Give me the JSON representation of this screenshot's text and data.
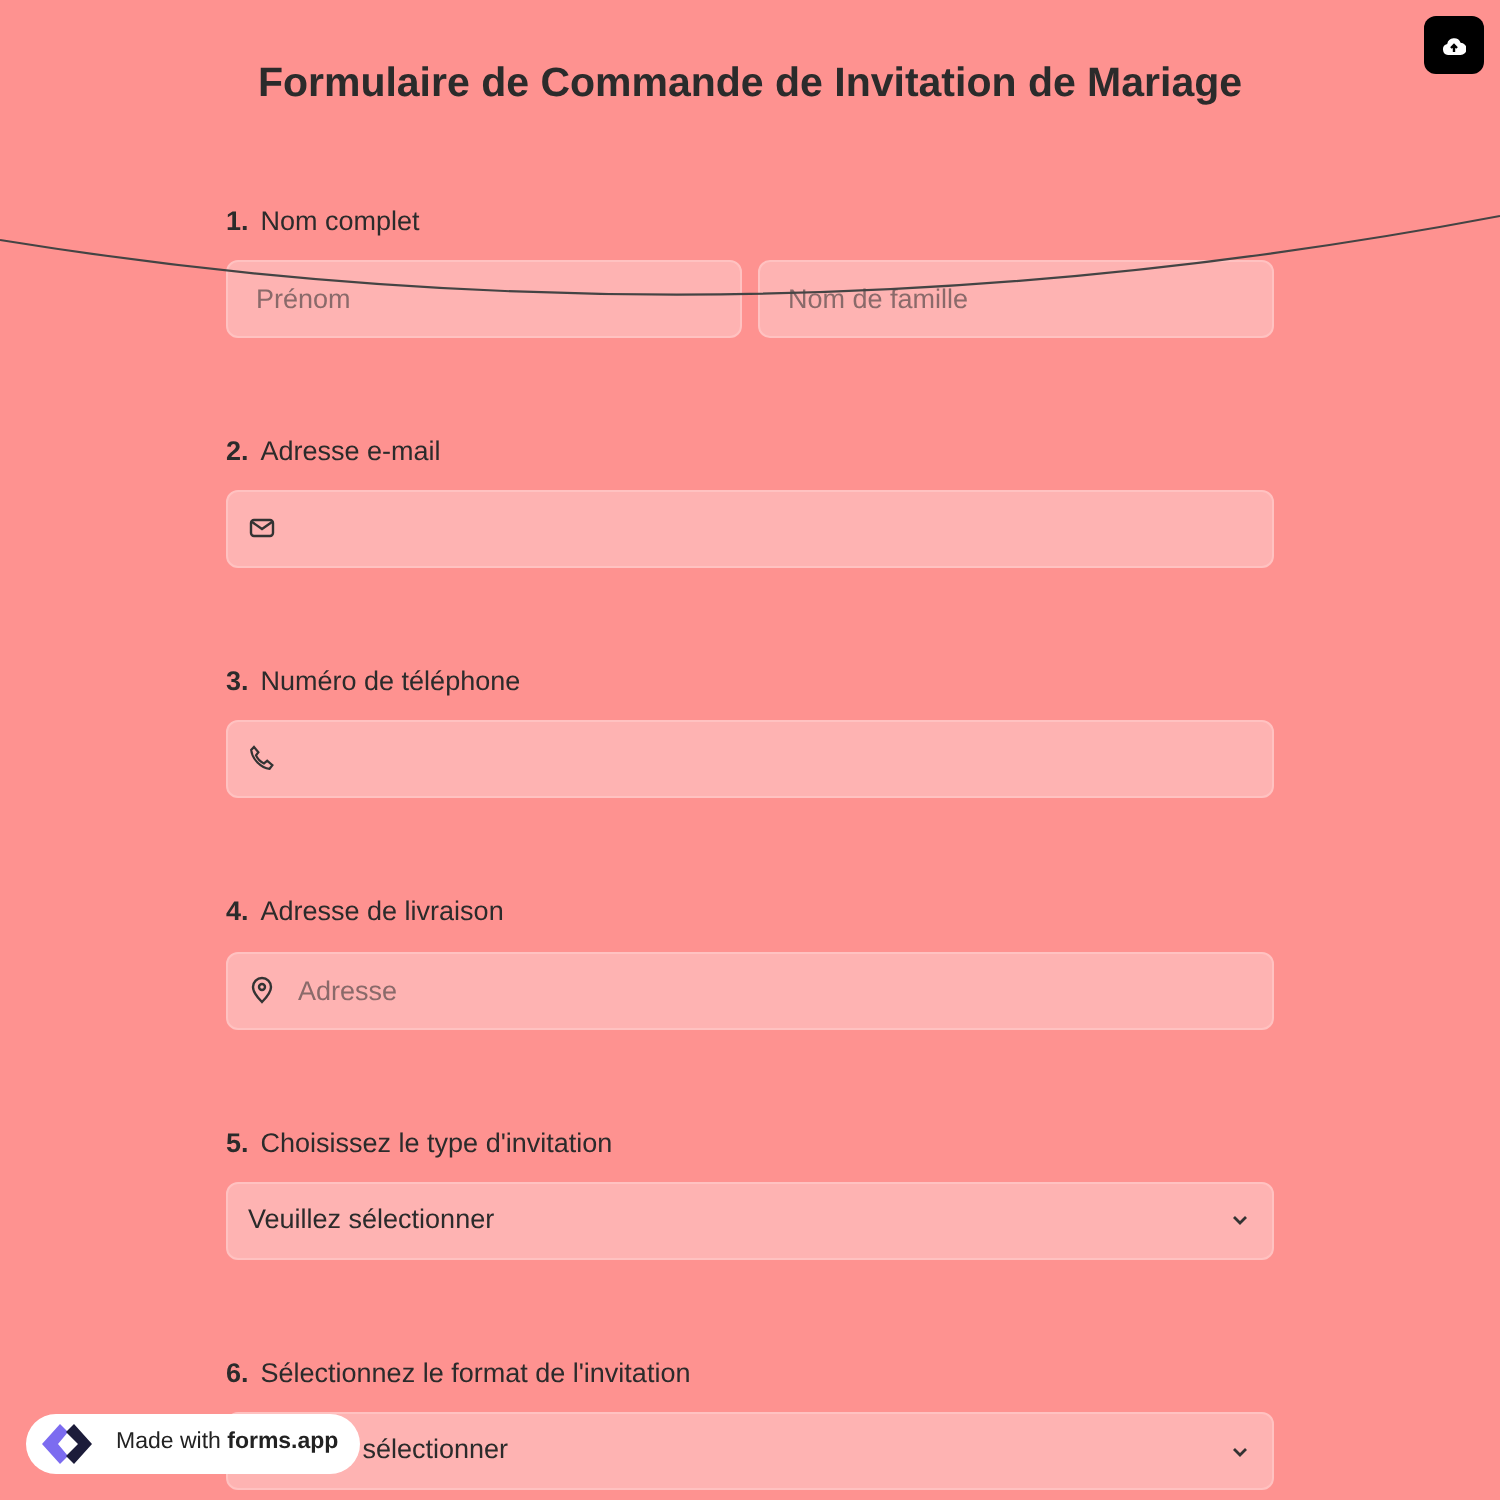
{
  "title": "Formulaire de Commande de Invitation de Mariage",
  "questions": [
    {
      "number": "1.",
      "label": "Nom complet",
      "kind": "pair",
      "fields": [
        {
          "placeholder": "Prénom"
        },
        {
          "placeholder": "Nom de famille"
        }
      ]
    },
    {
      "number": "2.",
      "label": "Adresse e-mail",
      "kind": "email-input"
    },
    {
      "number": "3.",
      "label": "Numéro de téléphone",
      "kind": "phone-input"
    },
    {
      "number": "4.",
      "label": "Adresse de livraison",
      "kind": "address-input",
      "placeholder": "Adresse"
    },
    {
      "number": "5.",
      "label": "Choisissez le type d'invitation",
      "kind": "select",
      "value": "Veuillez sélectionner"
    },
    {
      "number": "6.",
      "label": "Sélectionnez le format de l'invitation",
      "kind": "select",
      "value": "sélectionner"
    }
  ],
  "badge": {
    "text": "Made with **forms.app**"
  }
}
